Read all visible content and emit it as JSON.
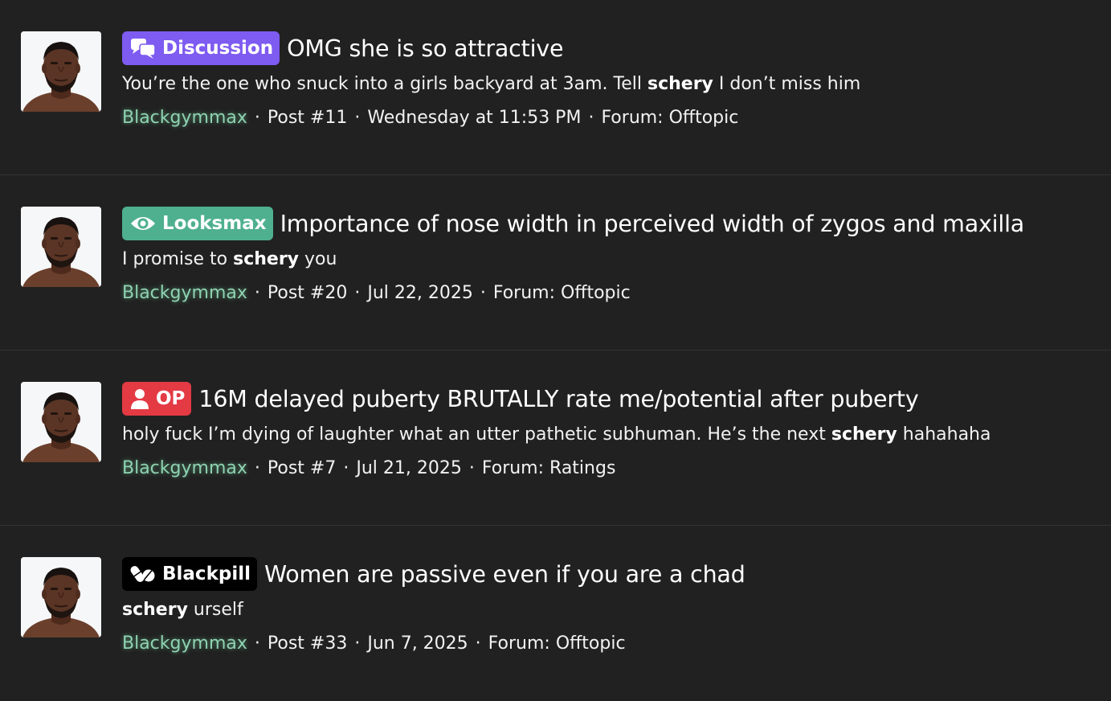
{
  "colors": {
    "background": "#212121",
    "prefix_discussion": "#7e5bf1",
    "prefix_looksmax": "#4eb08e",
    "prefix_op": "#e33a44",
    "prefix_blackpill": "#000000",
    "username": "#8fd2b1"
  },
  "results": [
    {
      "prefix": {
        "label": "Discussion",
        "icon": "chat-bubbles-icon"
      },
      "title": "OMG she is so attractive",
      "snippet": {
        "before": "You’re the one who snuck into a girls backyard at 3am. Tell ",
        "highlight": "schery",
        "after": " I don’t miss him"
      },
      "username": "Blackgymmax",
      "post": "Post #11",
      "date": "Wednesday at 11:53 PM",
      "forum": "Forum: Offtopic"
    },
    {
      "prefix": {
        "label": "Looksmax",
        "icon": "eye-icon"
      },
      "title": "Importance of nose width in perceived width of zygos and maxilla",
      "snippet": {
        "before": "I promise to ",
        "highlight": "schery",
        "after": " you"
      },
      "username": "Blackgymmax",
      "post": "Post #20",
      "date": "Jul 22, 2025",
      "forum": "Forum: Offtopic"
    },
    {
      "prefix": {
        "label": "OP",
        "icon": "user-icon"
      },
      "title": "16M delayed puberty BRUTALLY rate me/potential after puberty",
      "snippet": {
        "before": "holy fuck I’m dying of laughter what an utter pathetic subhuman. He’s the next ",
        "highlight": "schery",
        "after": " hahahaha"
      },
      "username": "Blackgymmax",
      "post": "Post #7",
      "date": "Jul 21, 2025",
      "forum": "Forum: Ratings"
    },
    {
      "prefix": {
        "label": "Blackpill",
        "icon": "pills-icon"
      },
      "title": "Women are passive even if you are a chad",
      "snippet": {
        "before": "",
        "highlight": "schery",
        "after": " urself"
      },
      "username": "Blackgymmax",
      "post": "Post #33",
      "date": "Jun 7, 2025",
      "forum": "Forum: Offtopic"
    }
  ],
  "separator": "·"
}
